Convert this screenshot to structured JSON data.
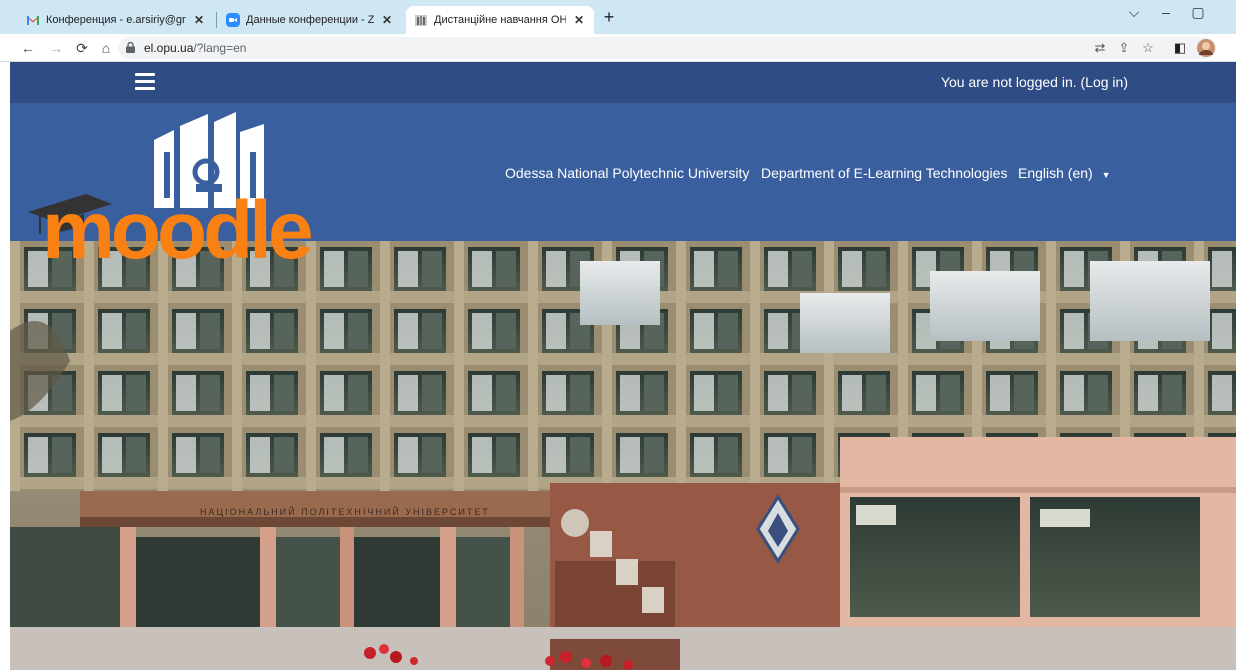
{
  "browser": {
    "tabs": [
      {
        "title": "Конференция - e.arsiriy@gmail.c",
        "icon": "gmail-icon",
        "active": false
      },
      {
        "title": "Данные конференции - Zoom",
        "icon": "zoom-icon",
        "active": false
      },
      {
        "title": "Дистанційне навчання ОНПУ",
        "icon": "moodle-favicon-icon",
        "active": true
      }
    ],
    "new_tab": "+",
    "close": "✕",
    "address": {
      "host": "el.opu.ua",
      "path": "/?lang=en"
    }
  },
  "page": {
    "login_status": "You are not logged in. (Log in)",
    "nav": {
      "university": "Odessa National Polytechnic University",
      "department": "Department of E-Learning Technologies",
      "language": "English (en)"
    },
    "logo": {
      "text": "moodle"
    }
  },
  "colors": {
    "tabbar": "#cfe7f3",
    "topnav": "#2f4c84",
    "header": "#3a5f9f",
    "moodle_orange": "#f98012"
  }
}
